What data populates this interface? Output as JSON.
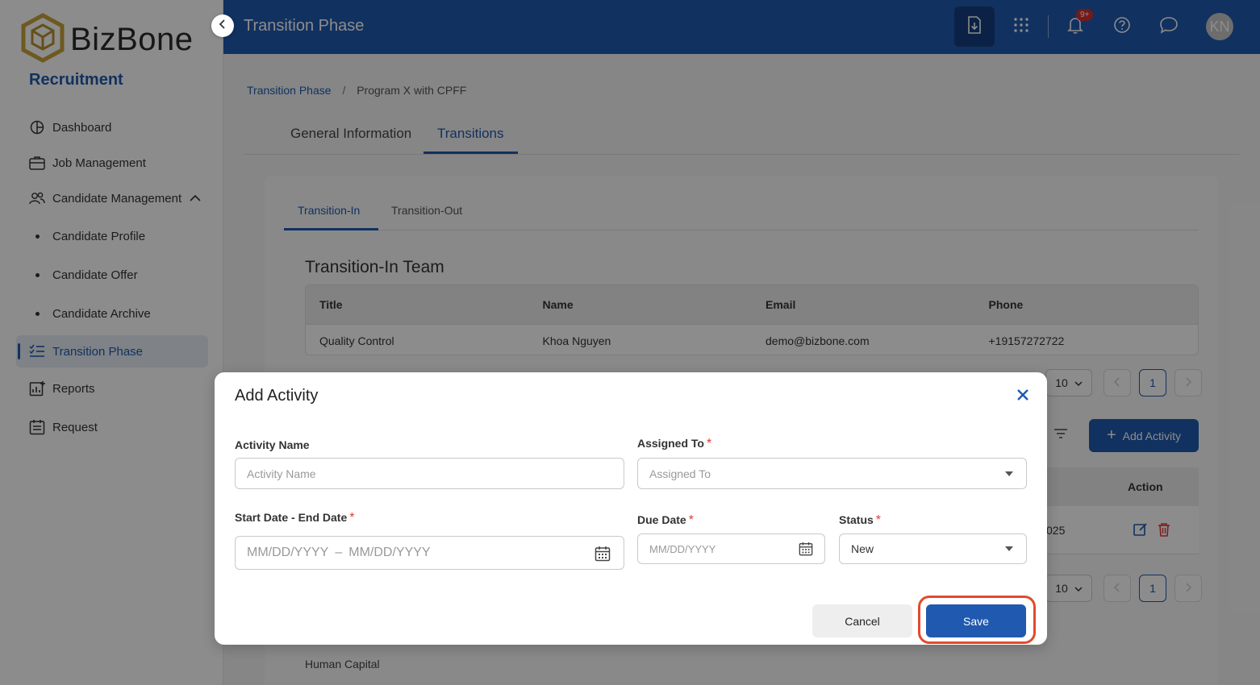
{
  "sidebar": {
    "logo_text": "BizBone",
    "module": "Recruitment",
    "items": [
      {
        "label": "Dashboard"
      },
      {
        "label": "Job Management"
      },
      {
        "label": "Candidate Management"
      },
      {
        "label": "Candidate Profile"
      },
      {
        "label": "Candidate Offer"
      },
      {
        "label": "Candidate Archive"
      },
      {
        "label": "Transition Phase"
      },
      {
        "label": "Reports"
      },
      {
        "label": "Request"
      }
    ]
  },
  "header": {
    "title": "Transition Phase",
    "notification_badge": "9+",
    "avatar_initials": "KN"
  },
  "breadcrumb": {
    "root": "Transition Phase",
    "separator": "/",
    "current": "Program X with CPFF"
  },
  "tabs": {
    "general": "General Information",
    "transitions": "Transitions"
  },
  "subtabs": {
    "in": "Transition-In",
    "out": "Transition-Out"
  },
  "team": {
    "title": "Transition-In Team",
    "columns": [
      "Title",
      "Name",
      "Email",
      "Phone"
    ],
    "rows": [
      [
        "Quality Control",
        "Khoa Nguyen",
        "demo@bizbone.com",
        "+19157272722"
      ]
    ]
  },
  "pagination": {
    "page_size": "10",
    "current_page": "1"
  },
  "activities": {
    "add_button": "Add Activity",
    "action_header": "Action",
    "partial_cell": "025"
  },
  "next_section": "Human Capital",
  "modal": {
    "title": "Add Activity",
    "activity_name_label": "Activity Name",
    "activity_name_placeholder": "Activity Name",
    "assigned_to_label": "Assigned To",
    "assigned_to_placeholder": "Assigned To",
    "date_range_label": "Start Date - End Date",
    "start_placeholder": "MM/DD/YYYY",
    "range_dash": "–",
    "end_placeholder": "MM/DD/YYYY",
    "due_date_label": "Due Date",
    "due_date_placeholder": "MM/DD/YYYY",
    "status_label": "Status",
    "status_value": "New",
    "required_mark": "*",
    "cancel_label": "Cancel",
    "save_label": "Save"
  },
  "colors": {
    "brand_blue": "#2059b0",
    "required_red": "#e53935",
    "highlight_ring": "#e24a2e"
  }
}
